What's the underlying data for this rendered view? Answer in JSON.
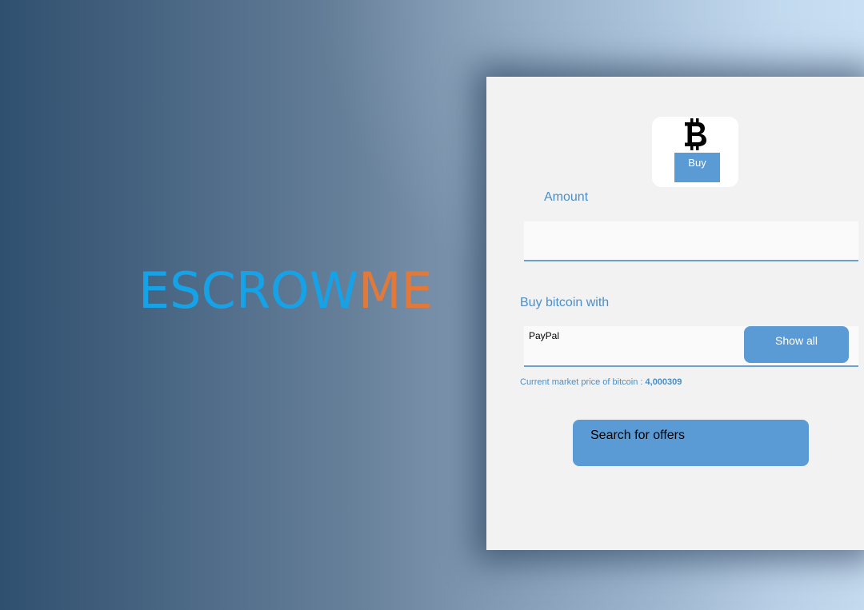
{
  "brand": {
    "part1": "ESCROW",
    "part2": "ME",
    "color_part1": "#16a2e6",
    "color_part2": "#e0793a"
  },
  "trade": {
    "coin_icon": "bitcoin-icon",
    "mode_tab": "Buy",
    "amount_label": "Amount",
    "amount_value": "",
    "payment_label": "Buy bitcoin with",
    "payment_method": "PayPal",
    "show_all_label": "Show all",
    "price_prefix": "Current market price of bitcoin : ",
    "price_value": "4,000309",
    "search_label": "Search for offers"
  },
  "colors": {
    "accent": "#5b9bd5",
    "label_text": "#4a8fc8",
    "panel_bg": "#f2f2f2"
  }
}
